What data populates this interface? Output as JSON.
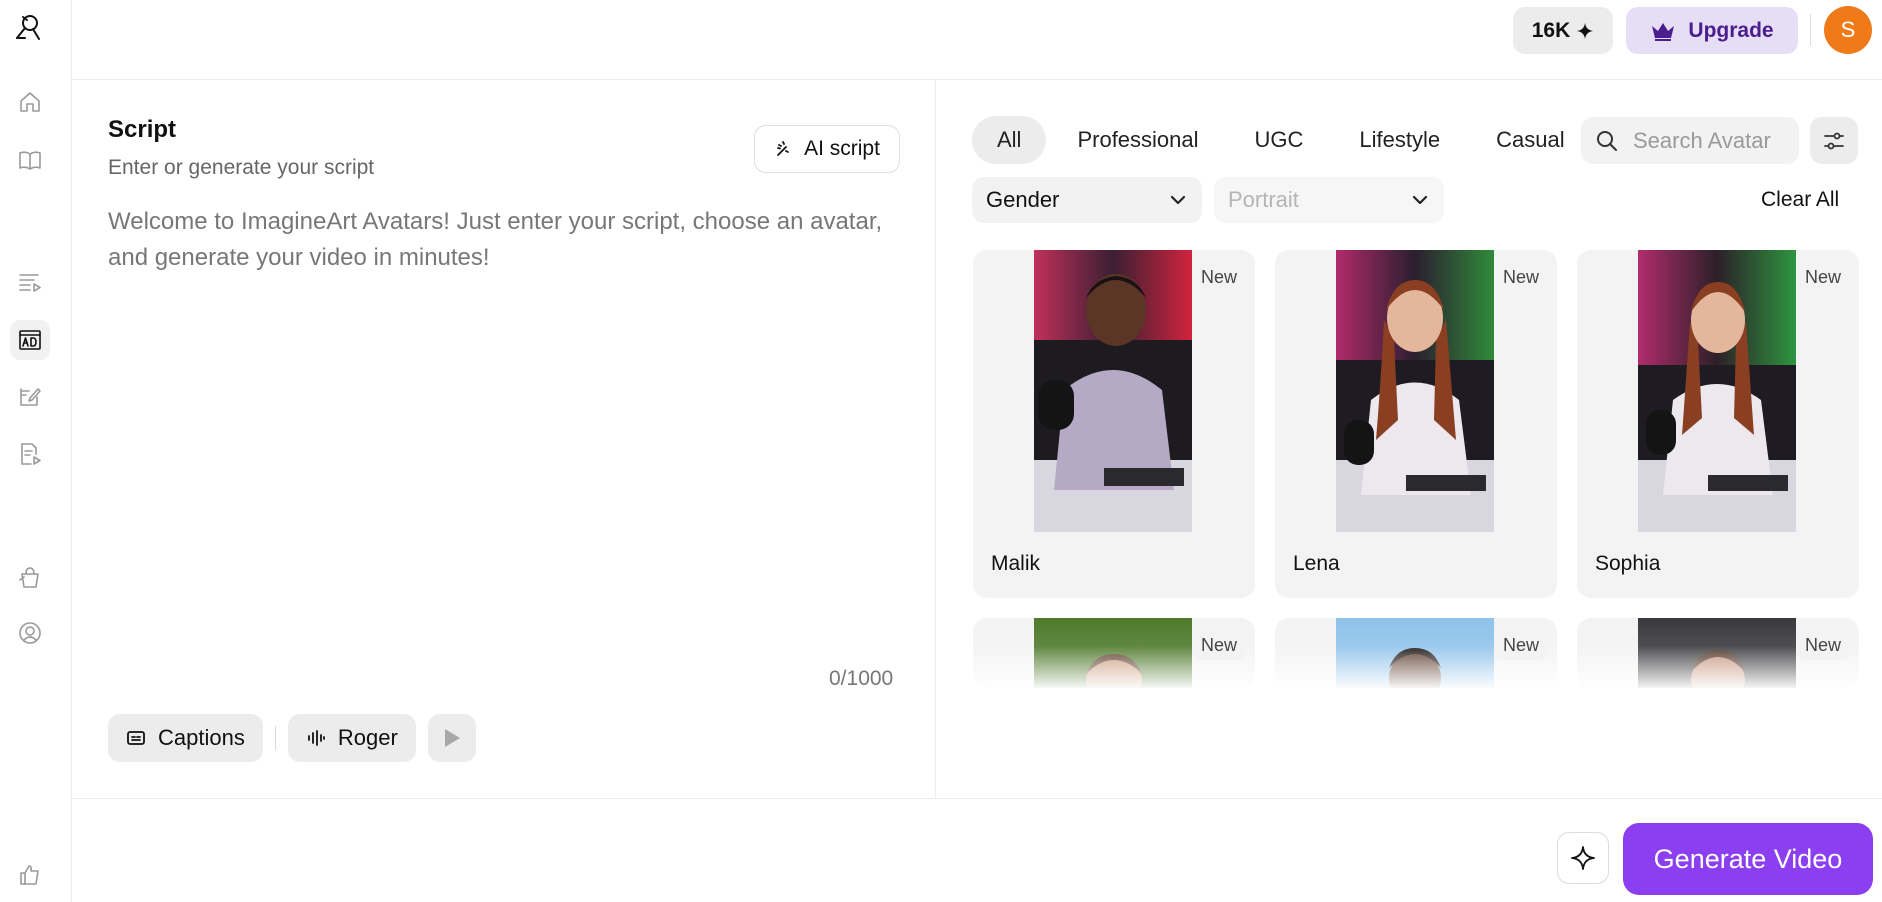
{
  "sidebar": {
    "items": [
      {
        "name": "home",
        "icon": "home-icon"
      },
      {
        "name": "library",
        "icon": "book-icon"
      },
      {
        "name": "script-video",
        "icon": "script-video-icon"
      },
      {
        "name": "ad-avatars",
        "icon": "ad-icon"
      },
      {
        "name": "editor",
        "icon": "edit-doc-icon"
      },
      {
        "name": "doc-video",
        "icon": "doc-video-icon"
      },
      {
        "name": "product",
        "icon": "bag-icon"
      },
      {
        "name": "avatar",
        "icon": "user-circle-icon"
      },
      {
        "name": "feedback",
        "icon": "thumbs-up-icon"
      }
    ],
    "active_index": 3
  },
  "topbar": {
    "credits": "16K",
    "upgrade_label": "Upgrade",
    "avatar_initial": "S"
  },
  "script": {
    "title": "Script",
    "subtitle": "Enter or generate your script",
    "ai_button": "AI script",
    "placeholder": "Welcome to ImagineArt Avatars! Just enter your script, choose an avatar, and generate your video in minutes!",
    "counter": "0/1000",
    "captions_label": "Captions",
    "voice_label": "Roger"
  },
  "avatars": {
    "categories": [
      "All",
      "Professional",
      "UGC",
      "Lifestyle",
      "Casual"
    ],
    "active_category": "All",
    "search_placeholder": "Search Avatar",
    "gender_label": "Gender",
    "portrait_label": "Portrait",
    "clear_all": "Clear All",
    "badge": "New",
    "cards": [
      {
        "name": "Malik",
        "badge": "New"
      },
      {
        "name": "Lena",
        "badge": "New"
      },
      {
        "name": "Sophia",
        "badge": "New"
      },
      {
        "name": "",
        "badge": "New"
      },
      {
        "name": "",
        "badge": "New"
      },
      {
        "name": "",
        "badge": "New"
      }
    ]
  },
  "footer": {
    "generate_label": "Generate Video"
  },
  "colors": {
    "accent": "#8b3ff0",
    "upgrade_bg": "#e6def5",
    "upgrade_text": "#4b1d8f",
    "avatar_bg": "#f07a18"
  }
}
